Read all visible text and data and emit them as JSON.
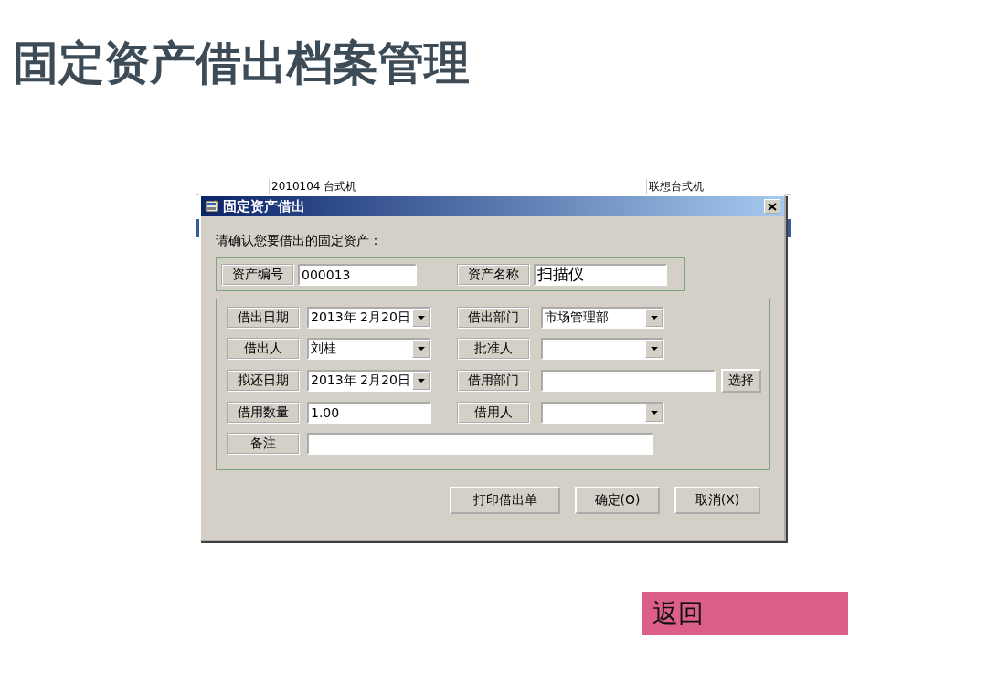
{
  "title": "固定资产借出档案管理",
  "background_row": {
    "cells": [
      "2010104 台式机",
      "联想台式机"
    ]
  },
  "dialog": {
    "title": "固定资产借出",
    "prompt": "请确认您要借出的固定资产：",
    "asset": [
      {
        "label": "资产编号",
        "value": "000013"
      },
      {
        "label": "资产名称",
        "value": "扫描仪"
      }
    ],
    "fields": [
      {
        "label": "借出日期",
        "kind": "combo",
        "value": "2013年 2月20日"
      },
      {
        "label": "借出部门",
        "kind": "combo",
        "value": "市场管理部"
      },
      {
        "label": "借出人",
        "kind": "combo",
        "value": "刘桂"
      },
      {
        "label": "批准人",
        "kind": "combo"
      },
      {
        "label": "拟还日期",
        "kind": "combo",
        "value": "2013年 2月20日"
      },
      {
        "label": "借用部门",
        "kind": "picker",
        "button": "选择"
      },
      {
        "label": "借用数量",
        "kind": "text",
        "value": "1.00"
      },
      {
        "label": "借用人",
        "kind": "combo"
      },
      {
        "label": "备注",
        "kind": "wide"
      }
    ],
    "buttons": [
      "打印借出单",
      "确定(O)",
      "取消(X)"
    ]
  },
  "back_button": "返回"
}
